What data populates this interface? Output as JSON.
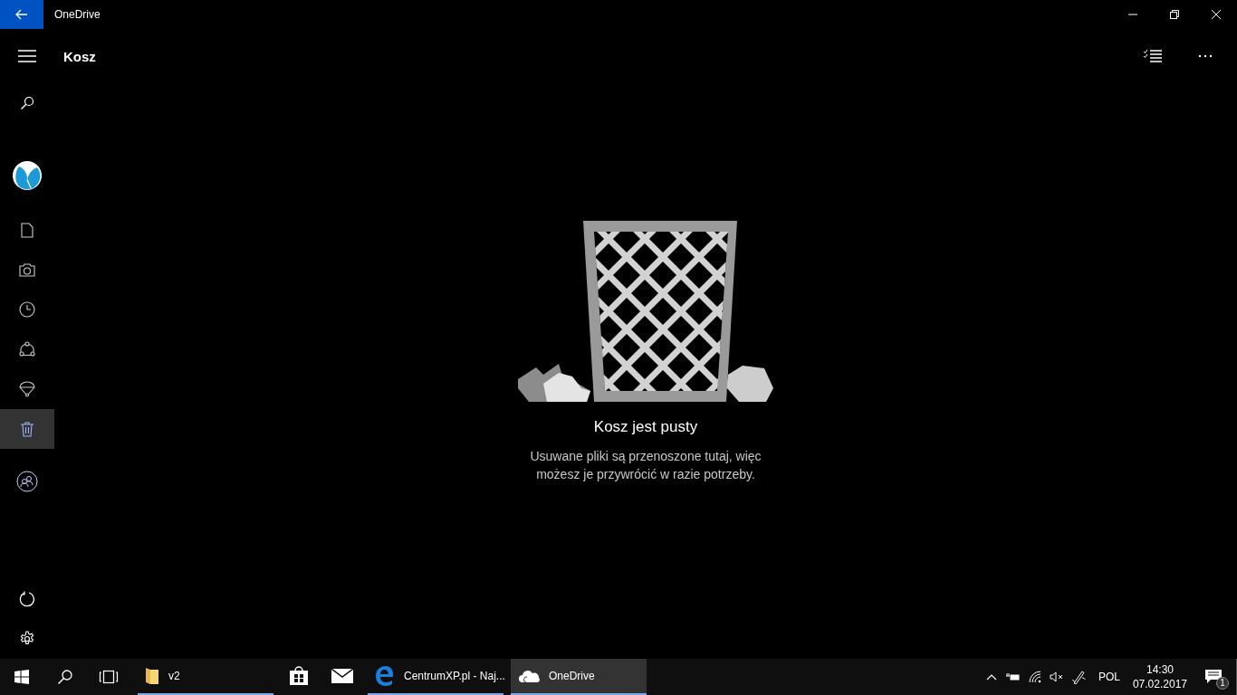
{
  "window": {
    "title": "OneDrive"
  },
  "page": {
    "title": "Kosz"
  },
  "sidebar": {
    "nav": [
      {
        "selected": false
      },
      {
        "selected": false
      },
      {
        "selected": false
      },
      {
        "selected": false
      },
      {
        "selected": false
      },
      {
        "selected": true
      }
    ]
  },
  "empty_state": {
    "title": "Kosz jest pusty",
    "message": "Usuwane pliki są przenoszone tutaj, więc możesz je przywrócić w razie potrzeby."
  },
  "taskbar": {
    "apps": [
      {
        "label": "v2",
        "running": true,
        "active": false
      },
      {
        "running": false,
        "active": false
      },
      {
        "running": false,
        "active": false
      },
      {
        "label": "CentrumXP.pl - Naj...",
        "running": true,
        "active": false
      },
      {
        "label": "OneDrive",
        "running": true,
        "active": true
      }
    ],
    "tray": {
      "language": "POL",
      "time": "14:30",
      "date": "07.02.2017",
      "notifications": "1"
    }
  }
}
